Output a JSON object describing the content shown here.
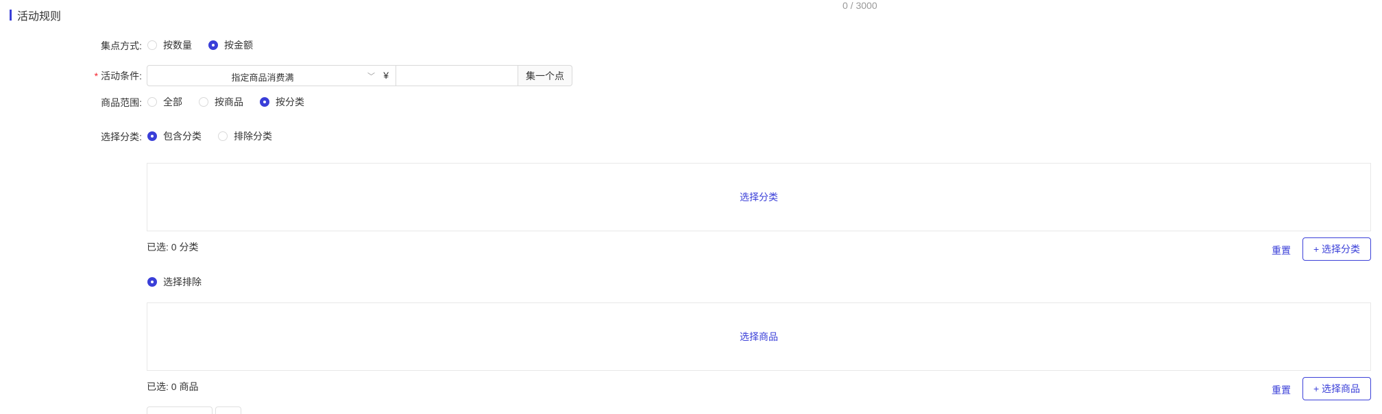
{
  "counter": "0 / 3000",
  "section": {
    "title": "活动规则"
  },
  "collect_method": {
    "label": "集点方式:",
    "options": [
      "按数量",
      "按金额"
    ],
    "selected": "按金额"
  },
  "condition": {
    "label": "活动条件:",
    "required": "*",
    "select_value": "指定商品消费满",
    "chevron_icon": "chevron-down-icon",
    "currency": "¥",
    "amount_value": "",
    "addon": "集一个点"
  },
  "scope": {
    "label": "商品范围:",
    "options": [
      "全部",
      "按商品",
      "按分类"
    ],
    "selected": "按分类"
  },
  "category": {
    "label": "选择分类:",
    "options": [
      "包含分类",
      "排除分类"
    ],
    "selected": "包含分类",
    "picker_link": "选择分类",
    "selected_count": "已选: 0 分类",
    "reset": "重置",
    "add_button": "+ 选择分类"
  },
  "exclude": {
    "radio_label": "选择排除",
    "picker_link": "选择商品",
    "selected_count": "已选: 0 商品",
    "reset": "重置",
    "add_button": "+ 选择商品"
  },
  "colors": {
    "accent": "#3a3fd8",
    "required": "#f5222d",
    "border": "#d9d9d9"
  }
}
